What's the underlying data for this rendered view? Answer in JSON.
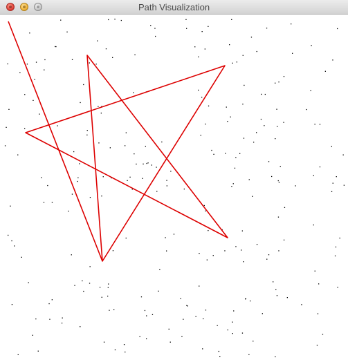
{
  "window": {
    "title": "Path Visualization"
  },
  "colors": {
    "path": "#dd0000",
    "points": "#000000",
    "background": "#ffffff"
  },
  "icons": {
    "close": "close-icon",
    "minimize": "minimize-icon",
    "zoom": "zoom-icon"
  }
}
